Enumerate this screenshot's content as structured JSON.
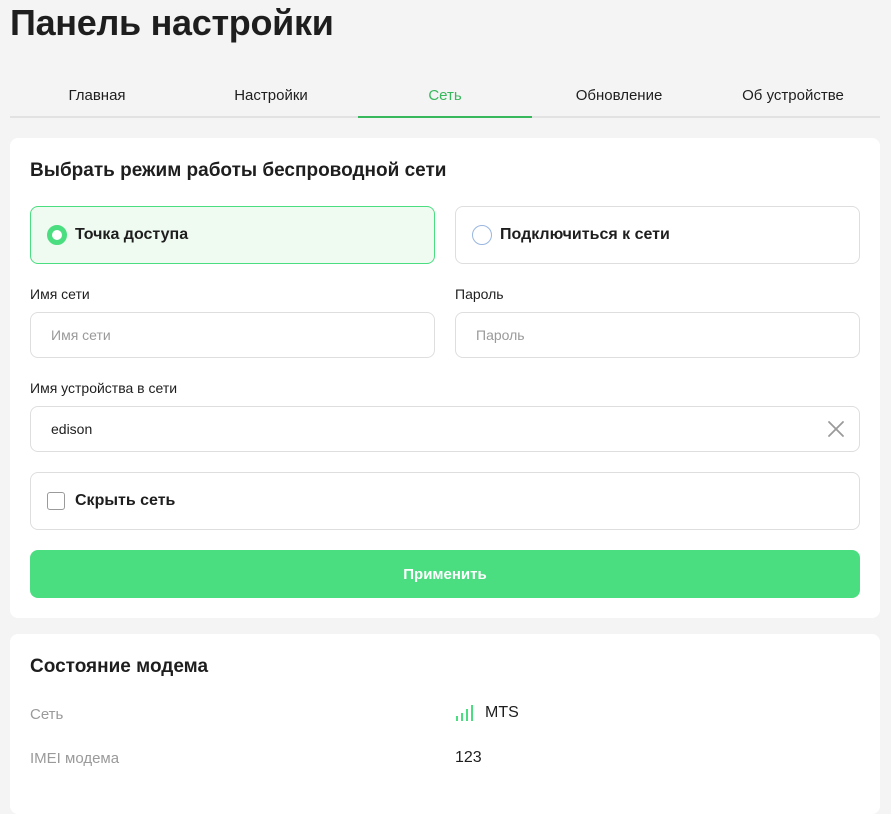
{
  "page": {
    "title": "Панель настройки"
  },
  "tabs": [
    {
      "label": "Главная",
      "active": false
    },
    {
      "label": "Настройки",
      "active": false
    },
    {
      "label": "Сеть",
      "active": true
    },
    {
      "label": "Обновление",
      "active": false
    },
    {
      "label": "Об устройстве",
      "active": false
    }
  ],
  "wireless": {
    "title": "Выбрать режим работы беспроводной сети",
    "modes": [
      {
        "label": "Точка доступа",
        "selected": true
      },
      {
        "label": "Подключиться к сети",
        "selected": false
      }
    ],
    "ssid": {
      "label": "Имя сети",
      "placeholder": "Имя сети",
      "value": ""
    },
    "password": {
      "label": "Пароль",
      "placeholder": "Пароль",
      "value": ""
    },
    "hostname": {
      "label": "Имя устройства в сети",
      "value": "edison"
    },
    "hide_network": {
      "label": "Скрыть сеть",
      "checked": false
    },
    "apply_label": "Применить"
  },
  "modem": {
    "title": "Состояние модема",
    "rows": [
      {
        "label": "Сеть",
        "value": "MTS",
        "icon": "signal-icon"
      },
      {
        "label": "IMEI модема",
        "value": "123"
      }
    ]
  },
  "colors": {
    "accent": "#4ade80",
    "tab_active": "#38b85c",
    "background": "#f4f4f4",
    "card": "#ffffff",
    "muted_text": "#9a9a9a"
  }
}
